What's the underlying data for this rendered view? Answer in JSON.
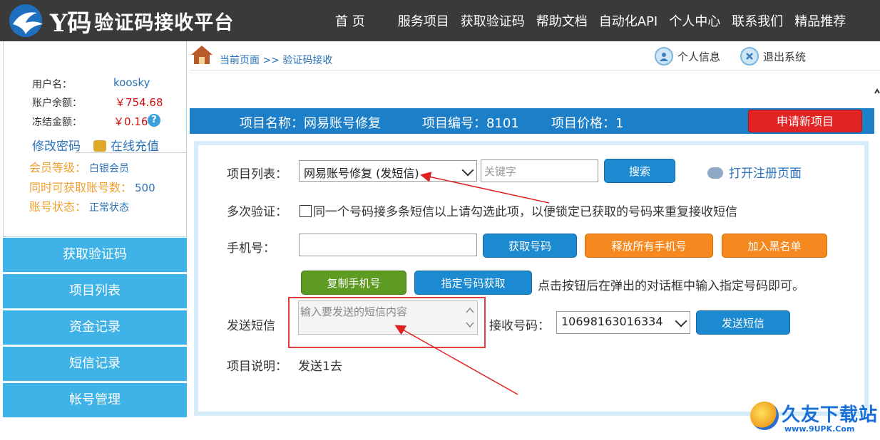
{
  "brand": {
    "logo_y": "Y码",
    "name": "验证码接收平台"
  },
  "nav": [
    "首 页",
    "服务项目",
    "获取验证码",
    "帮助文档",
    "自动化API",
    "个人中心",
    "联系我们",
    "精品推荐"
  ],
  "account": {
    "username_label": "用户名：",
    "username": "koosky",
    "balance_label": "账户余额：",
    "balance": "￥754.68",
    "frozen_label": "冻结金额：",
    "frozen": "￥0.16",
    "help_icon": "?",
    "change_password": "修改密码",
    "recharge": "在线充值",
    "level_label": "会员等级：",
    "level": "白银会员",
    "concurrent_label": "同时可获取账号数：",
    "concurrent": "500",
    "status_label": "账号状态：",
    "status": "正常状态"
  },
  "menu": [
    "获取验证码",
    "项目列表",
    "资金记录",
    "短信记录",
    "帐号管理"
  ],
  "breadcrumb": "当前页面 >> 验证码接收",
  "top_actions": {
    "profile": "个人信息",
    "logout": "退出系统"
  },
  "project": {
    "name": "项目名称：网易账号修复",
    "id": "项目编号：8101",
    "price": "项目价格：1",
    "new_button": "申请新项目"
  },
  "form": {
    "list_label": "项目列表：",
    "list_selected": "网易账号修复 (发短信)",
    "keyword_placeholder": "关键字",
    "search_button": "搜索",
    "open_register": "打开注册页面",
    "multi_label": "多次验证：",
    "multi_text": "同一个号码接多条短信以上请勾选此项，以便锁定已获取的号码来重复接收短信",
    "phone_label": "手机号：",
    "phone_value": "",
    "get_number": "获取号码",
    "release_all": "释放所有手机号",
    "blacklist": "加入黑名单",
    "copy_phone": "复制手机号",
    "specify_number": "指定号码获取",
    "specify_hint": "点击按钮后在弹出的对话框中输入指定号码即可。",
    "sms_label": "发送短信",
    "sms_placeholder": "输入要发送的短信内容",
    "receiver_label": "接收号码：",
    "receiver_value": "10698163016334",
    "send_button": "发送短信",
    "desc_label": "项目说明：",
    "desc_value": "发送1去"
  },
  "watermark": {
    "text": "久友下载站",
    "url": "www.9UPK.Com"
  },
  "colors": {
    "topbar": "#3a3a3a",
    "menu": "#3fb3e8",
    "projbar": "#1c7fc7",
    "danger": "#e32424",
    "accent_orange": "#f5891f",
    "accent_green": "#5d9b23"
  }
}
